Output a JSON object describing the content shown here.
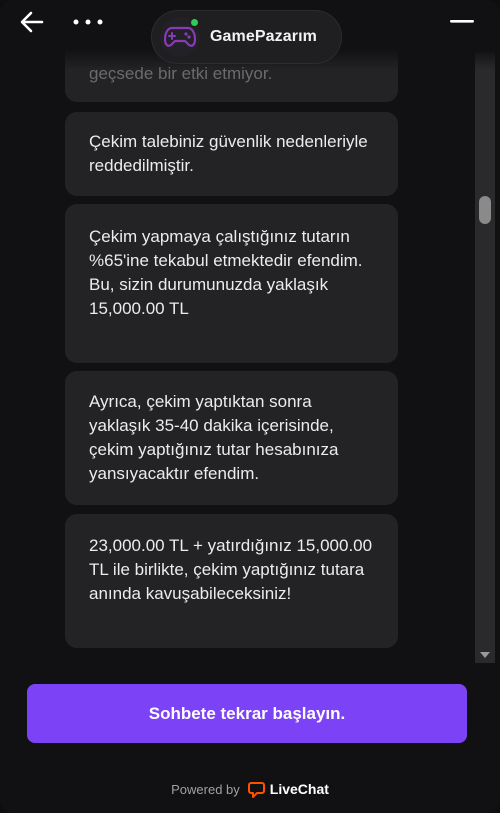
{
  "header": {
    "brand_name": "GamePazarım",
    "back_icon": "arrow-left-icon",
    "more_icon": "more-horizontal-icon",
    "minimize_icon": "minimize-icon",
    "avatar_icon": "gamepad-icon",
    "online": true
  },
  "messages": [
    {
      "text": "geçsede bir etki etmiyor.",
      "faded": true
    },
    {
      "text": "Çekim talebiniz güvenlik nedenleriyle reddedilmiştir."
    },
    {
      "text": "Çekim yapmaya çalıştığınız tutarın %65'ine tekabul etmektedir efendim. Bu, sizin durumunuzda yaklaşık 15,000.00 TL"
    },
    {
      "text": "Ayrıca, çekim yaptıktan sonra yaklaşık 35-40 dakika içerisinde, çekim yaptığınız tutar hesabınıza yansıyacaktır efendim."
    },
    {
      "text": "23,000.00 TL + yatırdığınız 15,000.00 TL ile birlikte, çekim yaptığınız tutara anında kavuşabileceksiniz!"
    }
  ],
  "footer": {
    "restart_label": "Sohbete tekrar başlayın.",
    "powered_by": "Powered by",
    "provider_name": "LiveChat"
  },
  "colors": {
    "accent": "#7b42f6",
    "bubble": "#232326",
    "background": "#111113",
    "online": "#34c759",
    "livechat": "#ff5100"
  }
}
